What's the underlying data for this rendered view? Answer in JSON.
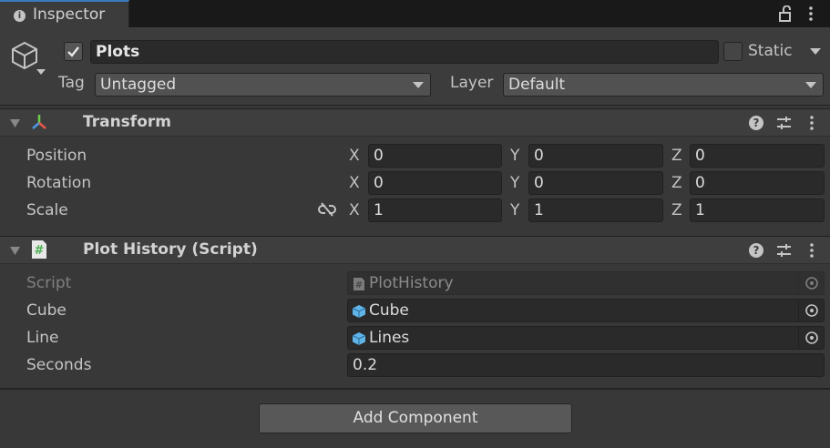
{
  "tab": {
    "title": "Inspector",
    "info_icon": "i"
  },
  "gameobject": {
    "active": true,
    "name": "Plots",
    "static_label": "Static",
    "tag_label": "Tag",
    "tag_value": "Untagged",
    "layer_label": "Layer",
    "layer_value": "Default"
  },
  "transform": {
    "title": "Transform",
    "help_icon": "?",
    "rows": [
      {
        "label": "Position",
        "x": "0",
        "y": "0",
        "z": "0"
      },
      {
        "label": "Rotation",
        "x": "0",
        "y": "0",
        "z": "0"
      },
      {
        "label": "Scale",
        "x": "1",
        "y": "1",
        "z": "1"
      }
    ],
    "axes": {
      "x": "X",
      "y": "Y",
      "z": "Z"
    }
  },
  "plot_history": {
    "title": "Plot History (Script)",
    "help_icon": "?",
    "script_glyph": "#",
    "fields": [
      {
        "label": "Script",
        "value": "PlotHistory"
      },
      {
        "label": "Cube",
        "value": "Cube"
      },
      {
        "label": "Line",
        "value": "Lines"
      },
      {
        "label": "Seconds",
        "value": "0.2"
      }
    ]
  },
  "footer": {
    "add_component_label": "Add Component"
  },
  "colors": {
    "accent": "#3a79bb",
    "background": "#383838",
    "field": "#2a2a2a",
    "prefab": "#5fb4e8",
    "script_icon": "#4caf50"
  },
  "icons": [
    "info-icon",
    "lock-icon",
    "kebab-menu-icon",
    "gameobject-cube-icon",
    "checkmark-icon",
    "transform-axes-icon",
    "script-icon",
    "help-icon",
    "presets-icon",
    "constrain-proportions-icon",
    "prefab-cube-icon",
    "object-picker-icon"
  ]
}
